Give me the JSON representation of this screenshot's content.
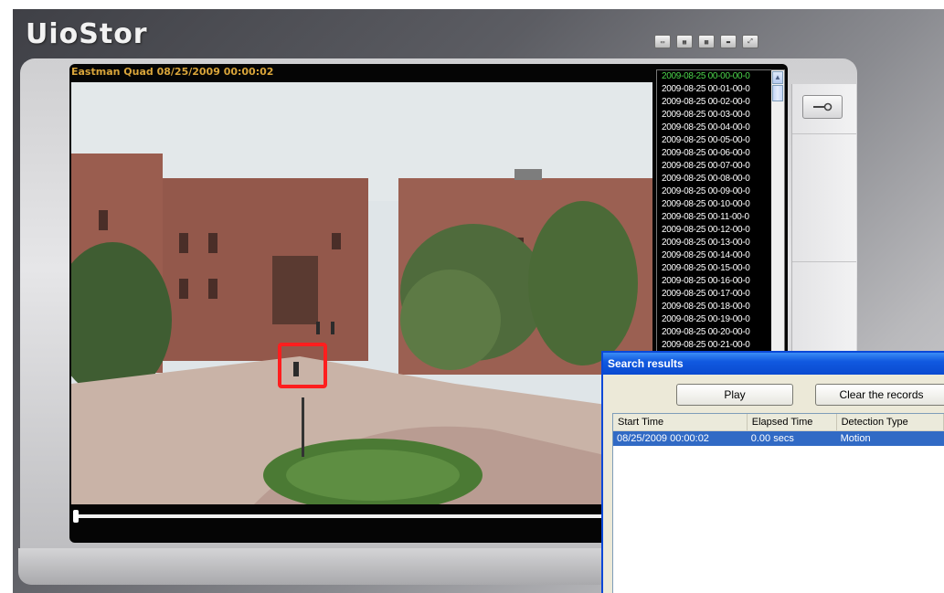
{
  "app": {
    "logo": "UioStor"
  },
  "toolbar": {
    "buttons": [
      {
        "icon": "layout-1-icon"
      },
      {
        "icon": "layout-4-icon"
      },
      {
        "icon": "layout-9-icon"
      },
      {
        "icon": "monitor-icon"
      },
      {
        "icon": "fullscreen-icon"
      }
    ]
  },
  "player": {
    "camera_label": "Eastman Quad 08/25/2009 00:00:02",
    "motion_box_color": "#ff1e1e",
    "playback_progress": 0.0
  },
  "side_panel": {
    "tools_icon": "wrench-icon"
  },
  "recordings": {
    "selected_index": 0,
    "items": [
      "2009-08-25 00-00-00-0",
      "2009-08-25 00-01-00-0",
      "2009-08-25 00-02-00-0",
      "2009-08-25 00-03-00-0",
      "2009-08-25 00-04-00-0",
      "2009-08-25 00-05-00-0",
      "2009-08-25 00-06-00-0",
      "2009-08-25 00-07-00-0",
      "2009-08-25 00-08-00-0",
      "2009-08-25 00-09-00-0",
      "2009-08-25 00-10-00-0",
      "2009-08-25 00-11-00-0",
      "2009-08-25 00-12-00-0",
      "2009-08-25 00-13-00-0",
      "2009-08-25 00-14-00-0",
      "2009-08-25 00-15-00-0",
      "2009-08-25 00-16-00-0",
      "2009-08-25 00-17-00-0",
      "2009-08-25 00-18-00-0",
      "2009-08-25 00-19-00-0",
      "2009-08-25 00-20-00-0",
      "2009-08-25 00-21-00-0"
    ]
  },
  "search_results": {
    "title": "Search results",
    "play_label": "Play",
    "clear_label": "Clear the records",
    "columns": [
      "Start Time",
      "Elapsed Time",
      "Detection Type"
    ],
    "rows": [
      [
        "08/25/2009 00:00:02",
        "0.00 secs",
        "Motion"
      ]
    ]
  }
}
